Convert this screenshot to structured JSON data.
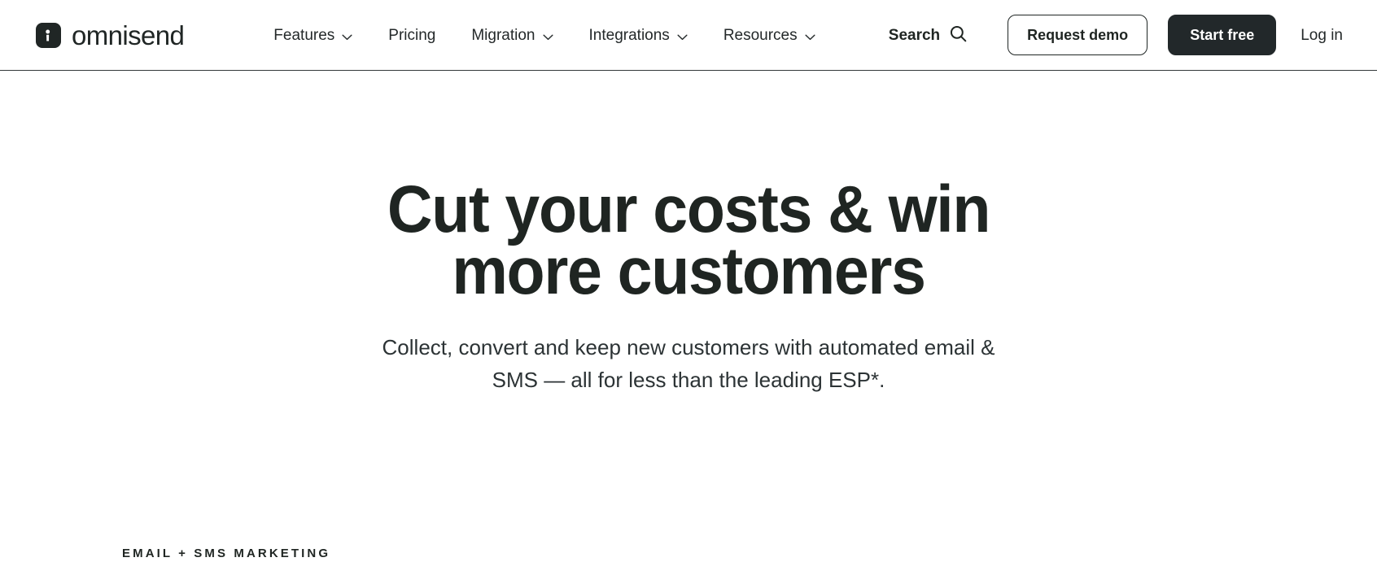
{
  "header": {
    "logo": {
      "text": "omnisend",
      "mark_icon": "omnisend-logo-mark",
      "mark_color": "#202625"
    },
    "nav": [
      {
        "label": "Features",
        "has_dropdown": true,
        "icon": "chevron-down-icon"
      },
      {
        "label": "Pricing",
        "has_dropdown": false,
        "icon": ""
      },
      {
        "label": "Migration",
        "has_dropdown": true,
        "icon": "chevron-down-icon"
      },
      {
        "label": "Integrations",
        "has_dropdown": true,
        "icon": "chevron-down-icon"
      },
      {
        "label": "Resources",
        "has_dropdown": true,
        "icon": "chevron-down-icon"
      }
    ],
    "search": {
      "label": "Search",
      "icon": "search-icon"
    },
    "request_demo_label": "Request demo",
    "start_free_label": "Start free",
    "login_label": "Log in"
  },
  "hero": {
    "title": "Cut your costs & win more customers",
    "subtitle": "Collect, convert and keep new customers with automated email & SMS — all for less than the leading ESP*.",
    "eyebrow": "EMAIL + SMS MARKETING"
  },
  "colors": {
    "ink": "#1f2522",
    "button_dark": "#22282a",
    "page_background": "#ffffff",
    "divider": "#33393a"
  }
}
